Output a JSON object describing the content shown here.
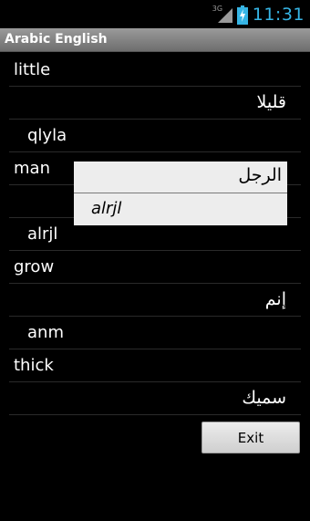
{
  "status_bar": {
    "network": "3G",
    "time": "11:31",
    "colors": {
      "clock": "#36b5e5",
      "battery": "#36b5e5"
    }
  },
  "app": {
    "title": "Arabic English"
  },
  "words": [
    {
      "english": "little",
      "arabic": "قليلا",
      "translit": "qlyla"
    },
    {
      "english": "man",
      "arabic": "",
      "translit": "alrjl"
    },
    {
      "english": "grow",
      "arabic": "إنم",
      "translit": "anm"
    },
    {
      "english": "thick",
      "arabic": "سميك",
      "translit": ""
    }
  ],
  "popup": {
    "arabic": "الرجل",
    "translit": "alrjl"
  },
  "exit_button": {
    "label": "Exit"
  }
}
